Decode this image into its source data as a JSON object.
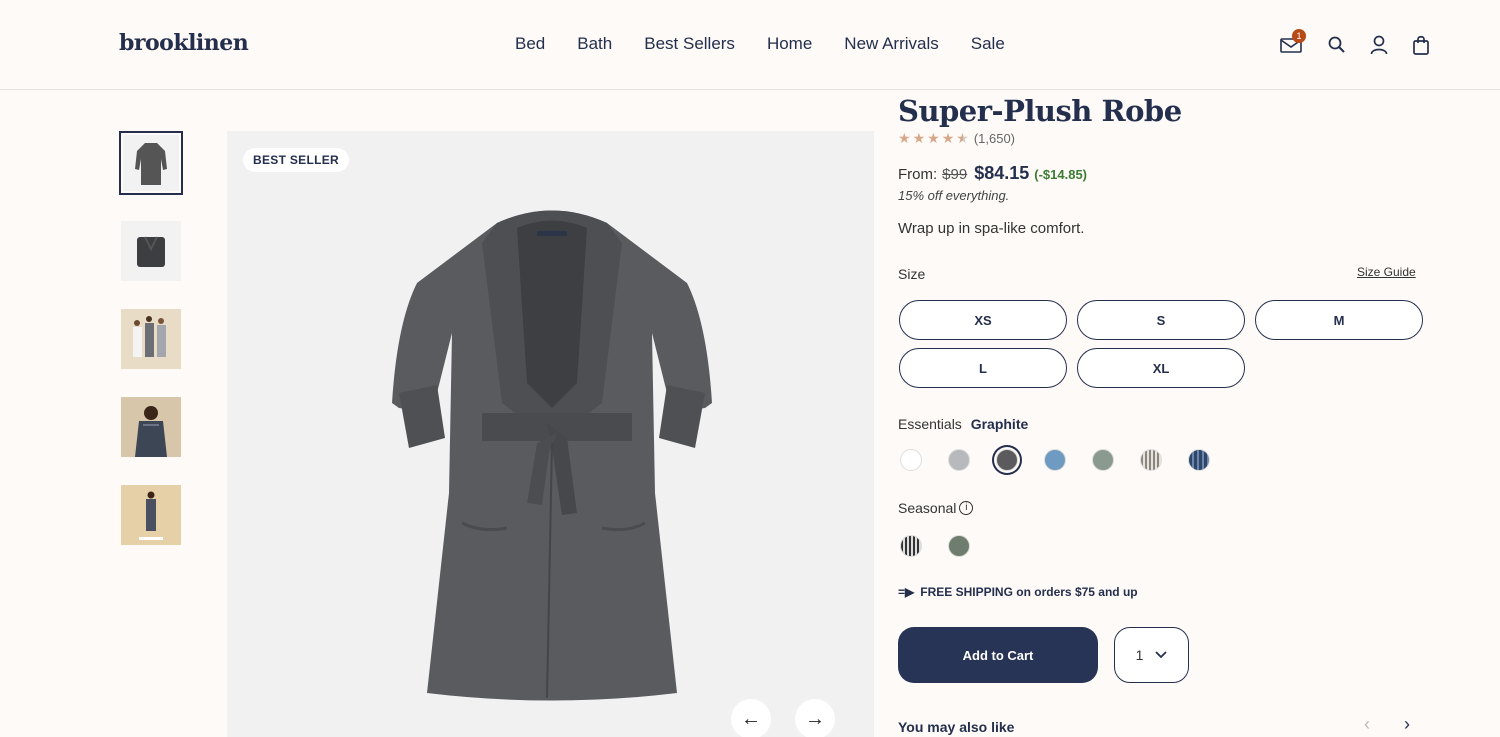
{
  "brand": {
    "logo": "brooklinen"
  },
  "nav": {
    "items": [
      "Bed",
      "Bath",
      "Best Sellers",
      "Home",
      "New Arrivals",
      "Sale"
    ]
  },
  "header_icons": {
    "mail_badge": "1",
    "icons": [
      "mail-icon",
      "search-icon",
      "account-icon",
      "bag-icon"
    ]
  },
  "gallery": {
    "tag": "BEST SELLER",
    "thumbnails": [
      "robe-front",
      "robe-folded",
      "group-models",
      "model-closeup",
      "model-full"
    ],
    "active_thumbnail": 0
  },
  "product": {
    "title": "Super-Plush Robe",
    "rating": 4.5,
    "review_count": "(1,650)",
    "price_from_label": "From:",
    "price_original": "$99",
    "price_sale": "$84.15",
    "price_savings": "(-$14.85)",
    "promo": "15% off everything.",
    "tagline": "Wrap up in spa-like comfort."
  },
  "size": {
    "label": "Size",
    "guide_link": "Size Guide",
    "options": [
      "XS",
      "S",
      "M",
      "L",
      "XL"
    ]
  },
  "colors": {
    "essentials_label": "Essentials",
    "selected_name": "Graphite",
    "essentials": [
      "#ffffff",
      "#b7b9bd",
      "#5b5b5e",
      "#6f9bc2",
      "#8a9a8e",
      "stripe-light",
      "stripe-blue"
    ],
    "selected_index": 2,
    "seasonal_label": "Seasonal",
    "seasonal": [
      "stripe-dark",
      "#6f7d6f"
    ]
  },
  "shipping": {
    "text": "FREE SHIPPING on orders $75 and up"
  },
  "cart": {
    "add_label": "Add to Cart",
    "quantity": "1"
  },
  "also_like": {
    "title": "You may also like"
  }
}
